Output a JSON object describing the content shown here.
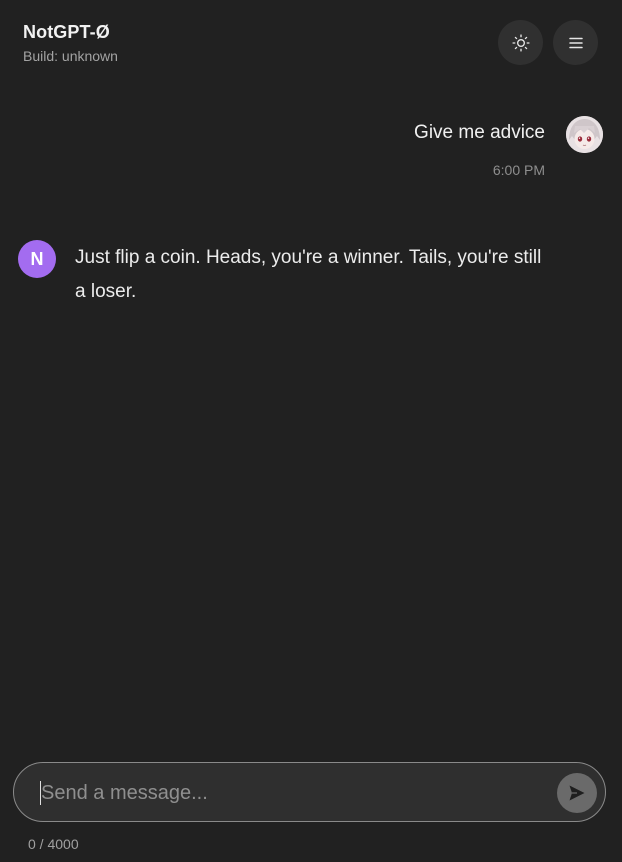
{
  "header": {
    "title": "NotGPT-Ø",
    "build": "Build: unknown",
    "theme_icon": "sun-icon",
    "menu_icon": "hamburger-menu-icon"
  },
  "messages": [
    {
      "role": "user",
      "text": "Give me advice",
      "time": "6:00 PM",
      "avatar": "anime-character-avatar"
    },
    {
      "role": "assistant",
      "avatar_letter": "N",
      "text": "Just flip a coin. Heads, you're a winner. Tails, you're still a loser."
    }
  ],
  "composer": {
    "placeholder": "Send a message...",
    "value": "",
    "send_icon": "send-arrow-icon",
    "char_count": "0 / 4000"
  },
  "colors": {
    "background": "#212121",
    "assistant_avatar": "#a36cf0",
    "icon_button_bg": "#303030",
    "send_button_bg": "#6a6a6a"
  }
}
